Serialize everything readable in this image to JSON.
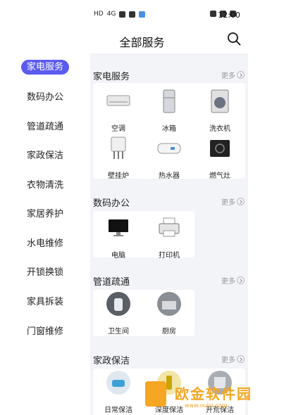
{
  "status": {
    "net": "HD",
    "sig": "4G",
    "time": "12:00"
  },
  "header": {
    "title": "全部服务"
  },
  "sidebar": {
    "items": [
      {
        "label": "家电服务",
        "active": true
      },
      {
        "label": "数码办公"
      },
      {
        "label": "管道疏通"
      },
      {
        "label": "家政保洁"
      },
      {
        "label": "衣物清洗"
      },
      {
        "label": "家居养护"
      },
      {
        "label": "水电维修"
      },
      {
        "label": "开锁换锁"
      },
      {
        "label": "家具拆装"
      },
      {
        "label": "门窗维修"
      }
    ]
  },
  "more_label": "更多",
  "sections": [
    {
      "title": "家电服务",
      "items": [
        {
          "label": "空调",
          "icon": "air-conditioner-icon"
        },
        {
          "label": "冰箱",
          "icon": "fridge-icon"
        },
        {
          "label": "洗衣机",
          "icon": "washing-machine-icon"
        },
        {
          "label": "壁挂炉",
          "icon": "boiler-icon"
        },
        {
          "label": "热水器",
          "icon": "water-heater-icon"
        },
        {
          "label": "燃气灶",
          "icon": "gas-stove-icon"
        }
      ]
    },
    {
      "title": "数码办公",
      "items": [
        {
          "label": "电脑",
          "icon": "computer-icon"
        },
        {
          "label": "打印机",
          "icon": "printer-icon"
        }
      ]
    },
    {
      "title": "管道疏通",
      "items": [
        {
          "label": "卫生间",
          "icon": "bathroom-icon"
        },
        {
          "label": "厨房",
          "icon": "kitchen-icon"
        }
      ]
    },
    {
      "title": "家政保洁",
      "items": [
        {
          "label": "日常保洁",
          "icon": "cleaning-icon"
        },
        {
          "label": "深度保洁",
          "icon": "deep-cleaning-icon"
        },
        {
          "label": "开荒保洁",
          "icon": "renovation-cleaning-icon"
        }
      ]
    }
  ],
  "watermark": {
    "text": "欧金软件园",
    "url": "www.oujin.com"
  }
}
